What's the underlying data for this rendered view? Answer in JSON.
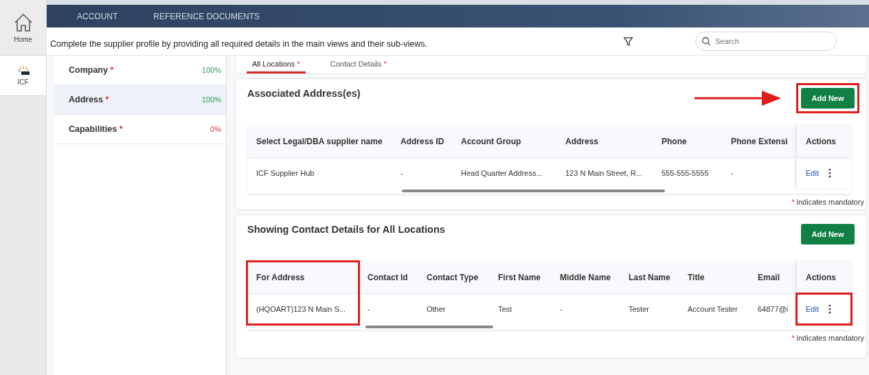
{
  "rail": [
    {
      "kind": "home",
      "label": "Home",
      "selected": false
    },
    {
      "kind": "logo",
      "label": "ICF",
      "selected": true
    }
  ],
  "top_nav": [
    "ACCOUNT",
    "REFERENCE DOCUMENTS"
  ],
  "instructions": "Complete the supplier profile by providing all required details in the main views and their sub-views.",
  "search": {
    "placeholder": "Search"
  },
  "sections": [
    {
      "label": "Company",
      "required_mark": "*",
      "percent": "100%",
      "complete": true,
      "selected": false
    },
    {
      "label": "Address",
      "required_mark": "*",
      "percent": "100%",
      "complete": true,
      "selected": true
    },
    {
      "label": "Capabilities",
      "required_mark": "*",
      "percent": "0%",
      "complete": false,
      "selected": false
    }
  ],
  "tabs": [
    {
      "label": "All Locations",
      "required_mark": "*",
      "selected": true
    },
    {
      "label": "Contact Details",
      "required_mark": "*",
      "selected": false
    }
  ],
  "panels": [
    {
      "title": "Associated Address(es)",
      "button": "Add New",
      "button_highlighted": true,
      "columns": [
        {
          "label": "Select Legal/DBA supplier name",
          "highlighted": false
        },
        {
          "label": "Address ID",
          "highlighted": false
        },
        {
          "label": "Account Group",
          "highlighted": false
        },
        {
          "label": "Address",
          "highlighted": false
        },
        {
          "label": "Phone",
          "highlighted": false
        },
        {
          "label": "Phone Extensi",
          "highlighted": false
        }
      ],
      "rows": [
        {
          "cells": [
            "ICF Supplier Hub",
            "-",
            "Head Quarter Address...",
            "123 N Main Street, R...",
            "555-555-5555",
            "-"
          ],
          "action": "Edit",
          "action_highlighted": false
        }
      ],
      "actions_heading": "Actions",
      "footnote_mark": "*",
      "footnote": "indicates mandatory"
    },
    {
      "title": "Showing Contact Details for All Locations",
      "button": "Add New",
      "button_highlighted": false,
      "columns": [
        {
          "label": "For Address",
          "highlighted": true
        },
        {
          "label": "Contact Id",
          "highlighted": false
        },
        {
          "label": "Contact Type",
          "highlighted": false
        },
        {
          "label": "First Name",
          "highlighted": false
        },
        {
          "label": "Middle Name",
          "highlighted": false
        },
        {
          "label": "Last Name",
          "highlighted": false
        },
        {
          "label": "Title",
          "highlighted": false
        },
        {
          "label": "Email",
          "highlighted": false
        }
      ],
      "rows": [
        {
          "cells": [
            "(HQOART)123 N Main S...",
            "-",
            "Other",
            "Test",
            "-",
            "Tester",
            "Account Tester",
            "64877@i"
          ],
          "action": "Edit",
          "action_highlighted": true
        }
      ],
      "actions_heading": "Actions",
      "footnote_mark": "*",
      "footnote": "indicates mandatory"
    }
  ]
}
